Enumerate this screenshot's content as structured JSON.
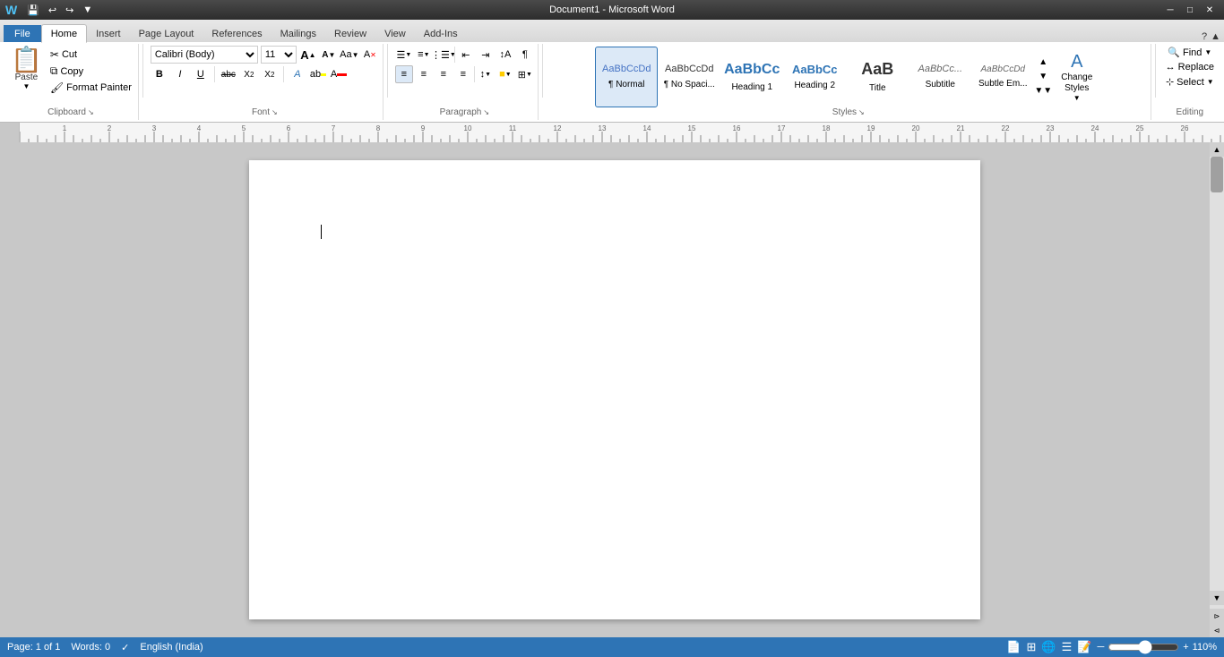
{
  "titlebar": {
    "title": "Document1 - Microsoft Word",
    "quick_access": [
      "save",
      "undo",
      "redo",
      "customize"
    ],
    "win_buttons": [
      "minimize",
      "restore",
      "close"
    ]
  },
  "tabs": [
    {
      "id": "file",
      "label": "File",
      "active": false,
      "is_file": true
    },
    {
      "id": "home",
      "label": "Home",
      "active": true
    },
    {
      "id": "insert",
      "label": "Insert",
      "active": false
    },
    {
      "id": "page_layout",
      "label": "Page Layout",
      "active": false
    },
    {
      "id": "references",
      "label": "References",
      "active": false
    },
    {
      "id": "mailings",
      "label": "Mailings",
      "active": false
    },
    {
      "id": "review",
      "label": "Review",
      "active": false
    },
    {
      "id": "view",
      "label": "View",
      "active": false
    },
    {
      "id": "addins",
      "label": "Add-Ins",
      "active": false
    }
  ],
  "ribbon": {
    "clipboard": {
      "label": "Clipboard",
      "paste_label": "Paste",
      "cut_label": "Cut",
      "copy_label": "Copy",
      "format_painter_label": "Format Painter"
    },
    "font": {
      "label": "Font",
      "font_name": "Calibri (Body)",
      "font_size": "11",
      "bold": "B",
      "italic": "I",
      "underline": "U",
      "strikethrough": "abc",
      "subscript": "X₂",
      "superscript": "X²",
      "grow": "A",
      "shrink": "A",
      "change_case": "Aa",
      "clear_format": "A",
      "text_highlight": "ab",
      "font_color": "A"
    },
    "paragraph": {
      "label": "Paragraph"
    },
    "styles": {
      "label": "Styles",
      "items": [
        {
          "id": "normal",
          "preview": "AaBbCcDd",
          "label": "¶ Normal",
          "active": true
        },
        {
          "id": "no_spacing",
          "preview": "AaBbCcDd",
          "label": "¶ No Spaci...",
          "active": false
        },
        {
          "id": "heading1",
          "preview": "AaBbCc",
          "label": "Heading 1",
          "active": false
        },
        {
          "id": "heading2",
          "preview": "AaBbCc",
          "label": "Heading 2",
          "active": false
        },
        {
          "id": "title",
          "preview": "AaB",
          "label": "Title",
          "active": false
        },
        {
          "id": "subtitle",
          "preview": "AaBbCc...",
          "label": "Subtitle",
          "active": false
        },
        {
          "id": "subtle_em",
          "preview": "AaBbCcDd",
          "label": "Subtle Em...",
          "active": false
        }
      ],
      "change_styles_label": "Change\nStyles"
    },
    "editing": {
      "label": "Editing",
      "find_label": "Find",
      "replace_label": "Replace",
      "select_label": "Select"
    }
  },
  "statusbar": {
    "page_info": "Page: 1 of 1",
    "words_label": "Words: 0",
    "language": "English (India)",
    "zoom_level": "110%"
  }
}
